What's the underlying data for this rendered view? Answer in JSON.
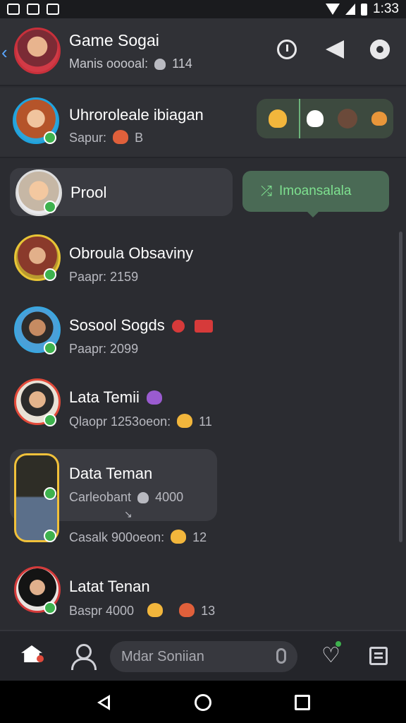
{
  "status_bar": {
    "time": "1:33"
  },
  "header": {
    "title": "Game Sogai",
    "subtitle": "Manis ooooal:",
    "count": "114"
  },
  "rows": {
    "pinned": {
      "name": "Uhroroleale ibiagan",
      "sub_label": "Sapur:",
      "sub_value": "B"
    },
    "prool": {
      "name": "Prool"
    },
    "action_label": "Imoansalala",
    "contact1": {
      "name": "Obroula Obsaviny",
      "sub": "Paapr: 2159"
    },
    "contact2": {
      "name": "Sosool Sogds",
      "sub": "Paapr: 2099"
    },
    "contact3": {
      "name": "Lata Temii",
      "sub": "Qlaopr 1253oeon:",
      "count": "11"
    },
    "contact4": {
      "name": "Data Teman",
      "sub": "Carleobant",
      "sub_value": "4000",
      "sub2": "Casalk 900oeon:",
      "count": "12"
    },
    "contact5": {
      "name": "Latat Tenan",
      "sub": "Baspr 4000",
      "count": "13"
    }
  },
  "search": {
    "placeholder": "Mdar Soniian"
  },
  "accent_green": "#3eb24e"
}
